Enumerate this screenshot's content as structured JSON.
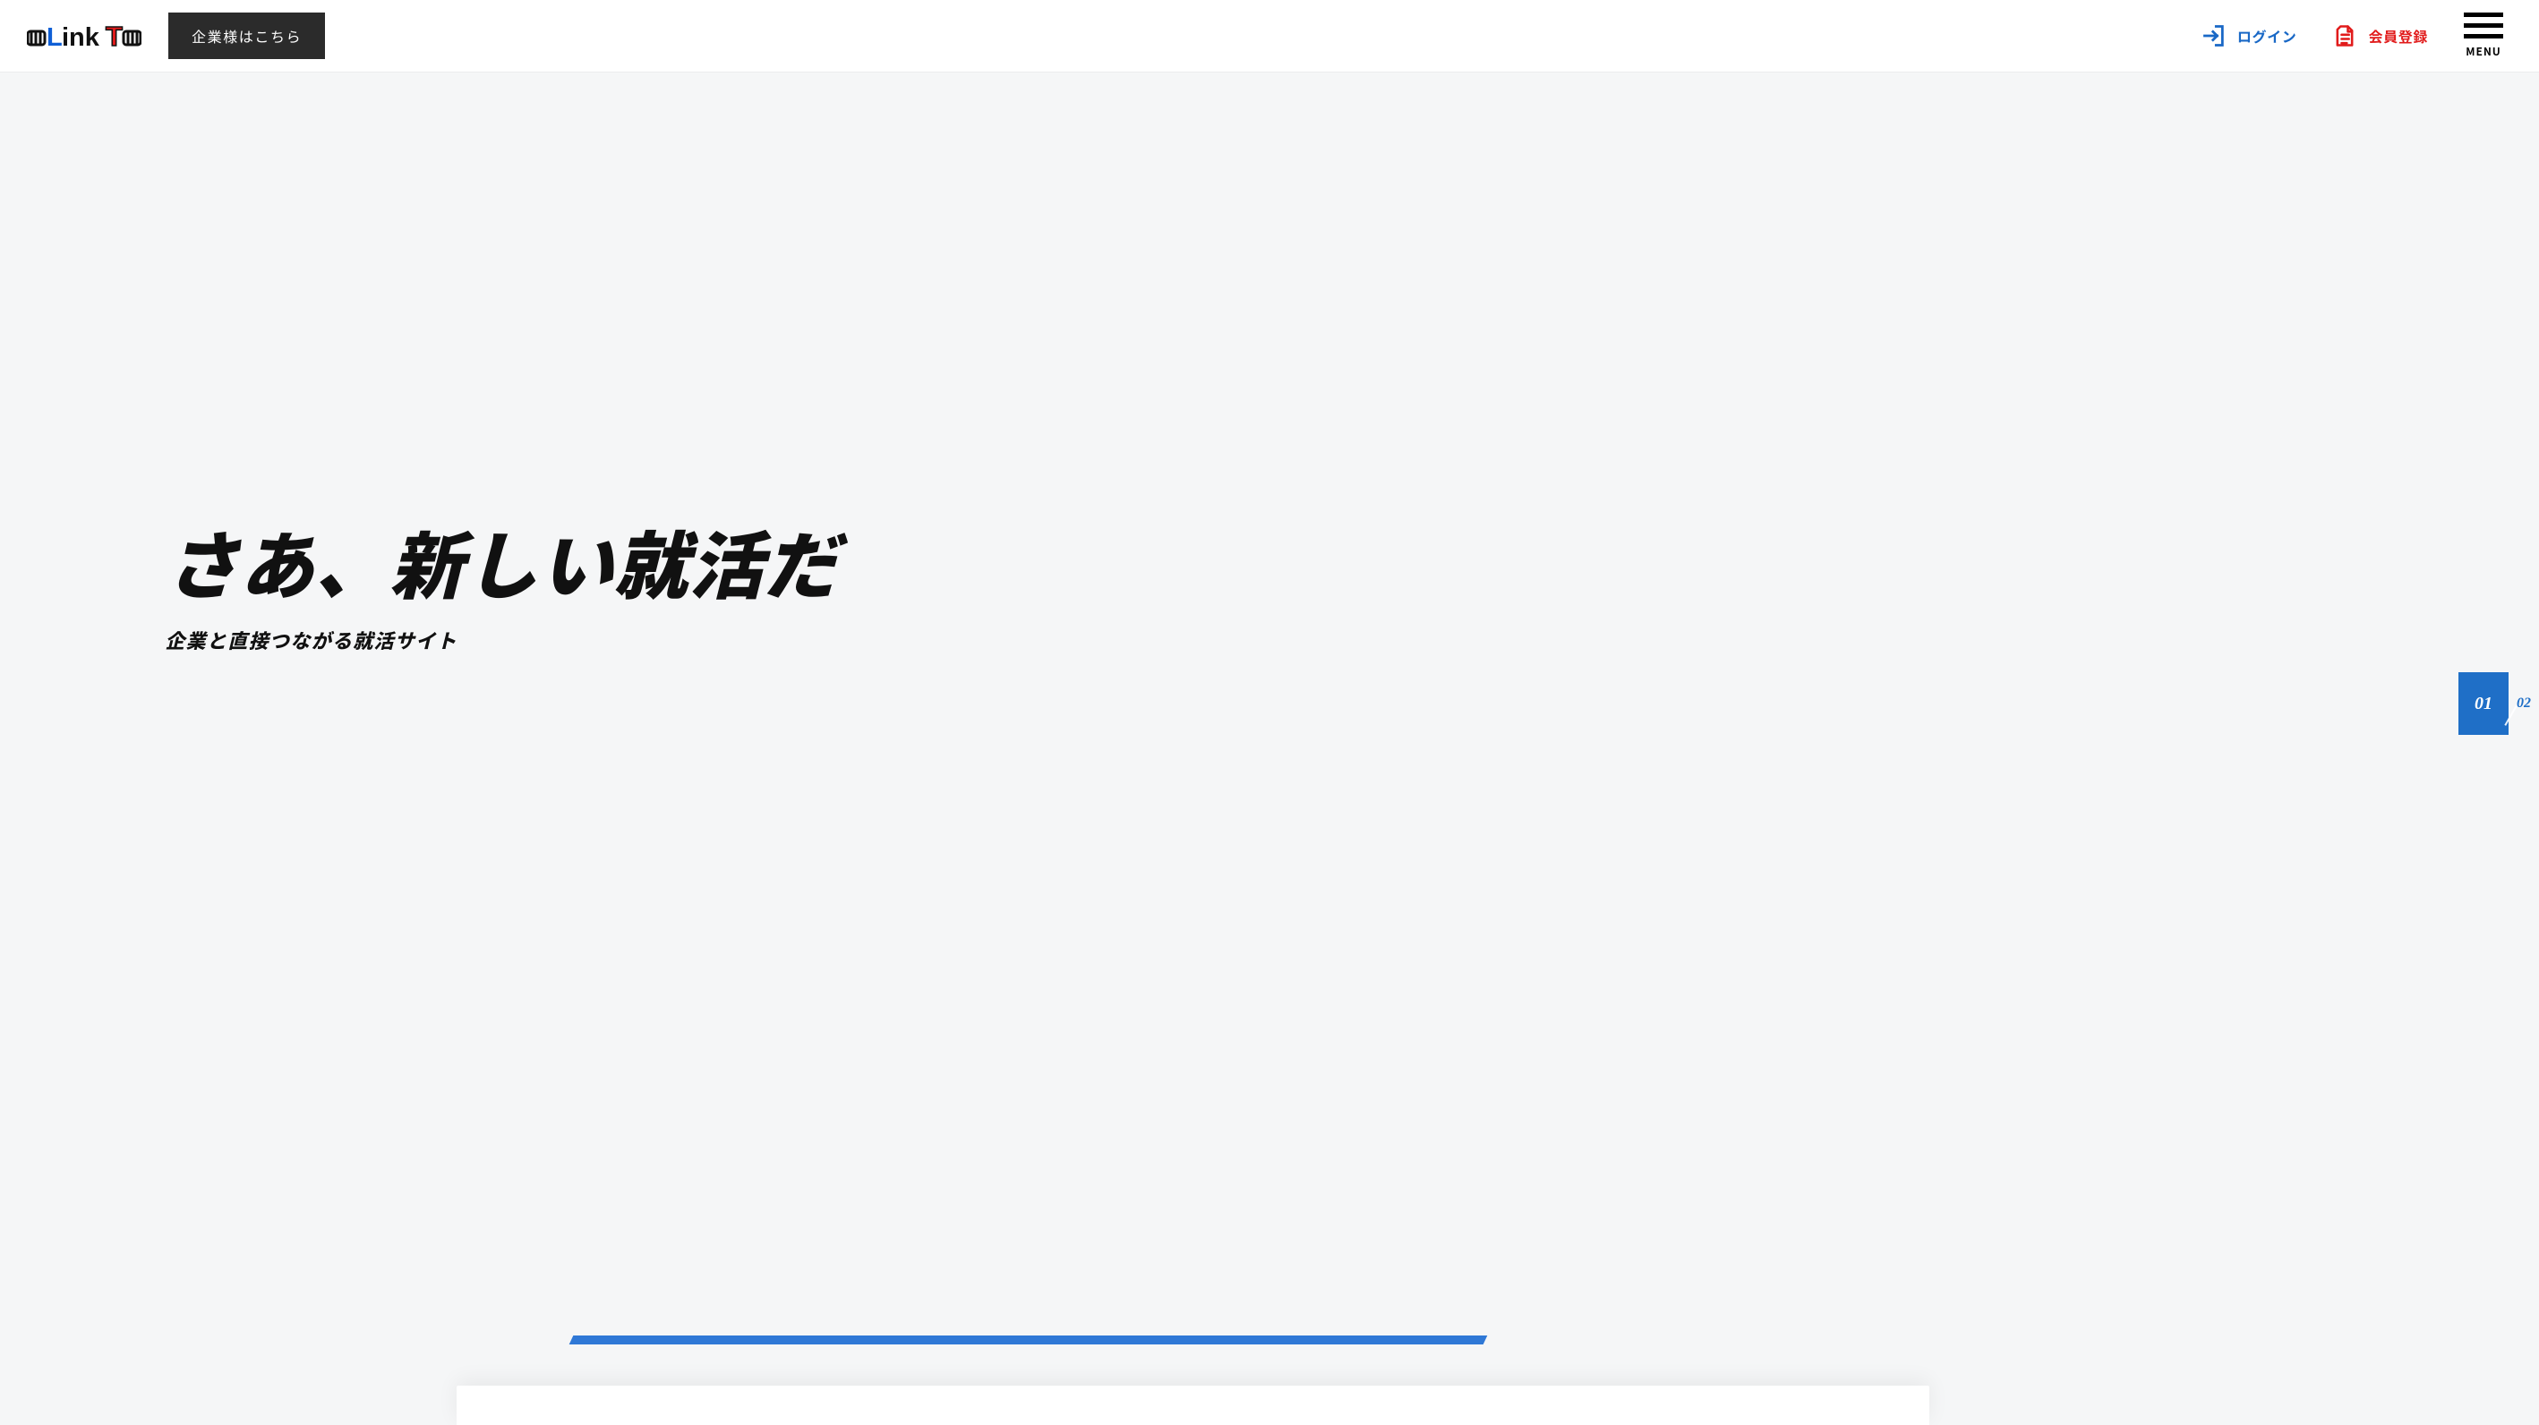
{
  "logo": {
    "alt": "LinkT",
    "text_parts": {
      "l": "L",
      "ink": "ink",
      "t": "T"
    },
    "colors": {
      "l": "#0f5fd6",
      "ink": "#111111",
      "t": "#e11b1b",
      "hand": "#111111"
    }
  },
  "header": {
    "company_button": "企業様はこちら",
    "login_label": "ログイン",
    "signup_label": "会員登録",
    "menu_label": "MENU"
  },
  "hero": {
    "title": "さあ、新しい就活だ",
    "subtitle": "企業と直接つながる就活サイト"
  },
  "slide": {
    "current": "01",
    "next": "02"
  },
  "colors": {
    "accent_blue": "#1f6fc7",
    "accent_red": "#e11b1b",
    "header_btn_bg": "#2b2b2b"
  }
}
